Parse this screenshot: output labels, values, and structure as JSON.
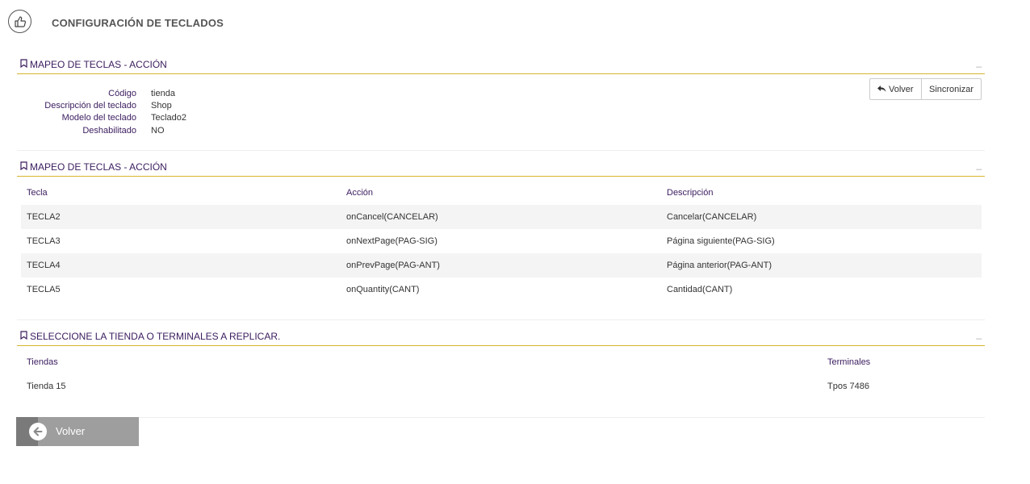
{
  "header": {
    "title": "CONFIGURACIÓN DE TECLADOS",
    "logo_icon": "thumbs-up-icon"
  },
  "section1": {
    "title": "MAPEO DE TECLAS - ACCIÓN",
    "collapse": "_",
    "fields": [
      {
        "label": "Código",
        "value": "tienda"
      },
      {
        "label": "Descripción del teclado",
        "value": "Shop"
      },
      {
        "label": "Modelo del teclado",
        "value": "Teclado2"
      },
      {
        "label": "Deshabilitado",
        "value": "NO"
      }
    ],
    "buttons": {
      "back": "Volver",
      "sync": "Sincronizar"
    }
  },
  "section2": {
    "title": "MAPEO DE TECLAS - ACCIÓN",
    "collapse": "_",
    "columns": [
      "Tecla",
      "Acción",
      "Descripción"
    ],
    "rows": [
      [
        "TECLA2",
        "onCancel(CANCELAR)",
        "Cancelar(CANCELAR)"
      ],
      [
        "TECLA3",
        "onNextPage(PAG-SIG)",
        "Página siguiente(PAG-SIG)"
      ],
      [
        "TECLA4",
        "onPrevPage(PAG-ANT)",
        "Página anterior(PAG-ANT)"
      ],
      [
        "TECLA5",
        "onQuantity(CANT)",
        "Cantidad(CANT)"
      ]
    ]
  },
  "section3": {
    "title": "SELECCIONE LA TIENDA O TERMINALES A REPLICAR.",
    "collapse": "_",
    "columns": [
      "Tiendas",
      "Terminales"
    ],
    "rows": [
      [
        "Tienda 15",
        "Tpos 7486"
      ]
    ]
  },
  "footer": {
    "back_label": "Volver"
  },
  "colors": {
    "accent": "#d8b530",
    "heading": "#3a1c5e",
    "back_button": "#9e9e9e"
  }
}
